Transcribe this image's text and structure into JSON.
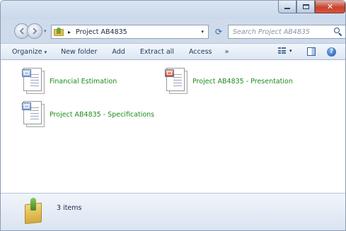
{
  "window": {
    "caption_buttons": {
      "minimize": "minimize-icon",
      "maximize": "maximize-icon",
      "close": "close-icon"
    },
    "close_glyph": "✕"
  },
  "address": {
    "path_separator": "▸",
    "breadcrumb": "Project AB4835",
    "dropdown_glyph": "▾",
    "refresh_glyph": "⟳",
    "recent_glyph": "▾",
    "search_placeholder": "Search Project AB4835"
  },
  "toolbar": {
    "organize": "Organize",
    "organize_dd": "▾",
    "new_folder": "New folder",
    "add": "Add",
    "extract_all": "Extract all",
    "access": "Access",
    "more": "»",
    "views_dd": "▾",
    "help_glyph": "?"
  },
  "files": [
    {
      "name": "Financial Estimation",
      "icon": "word-document-icon"
    },
    {
      "name": "Project AB4835 - Presentation",
      "icon": "powerpoint-document-icon"
    },
    {
      "name": "Project AB4835 - Specifications",
      "icon": "word-document-icon"
    }
  ],
  "status": {
    "item_count": "3 items"
  },
  "colors": {
    "file_label": "#1d8c1d",
    "toolbar_text": "#1e395b",
    "close_button": "#c7432c"
  }
}
